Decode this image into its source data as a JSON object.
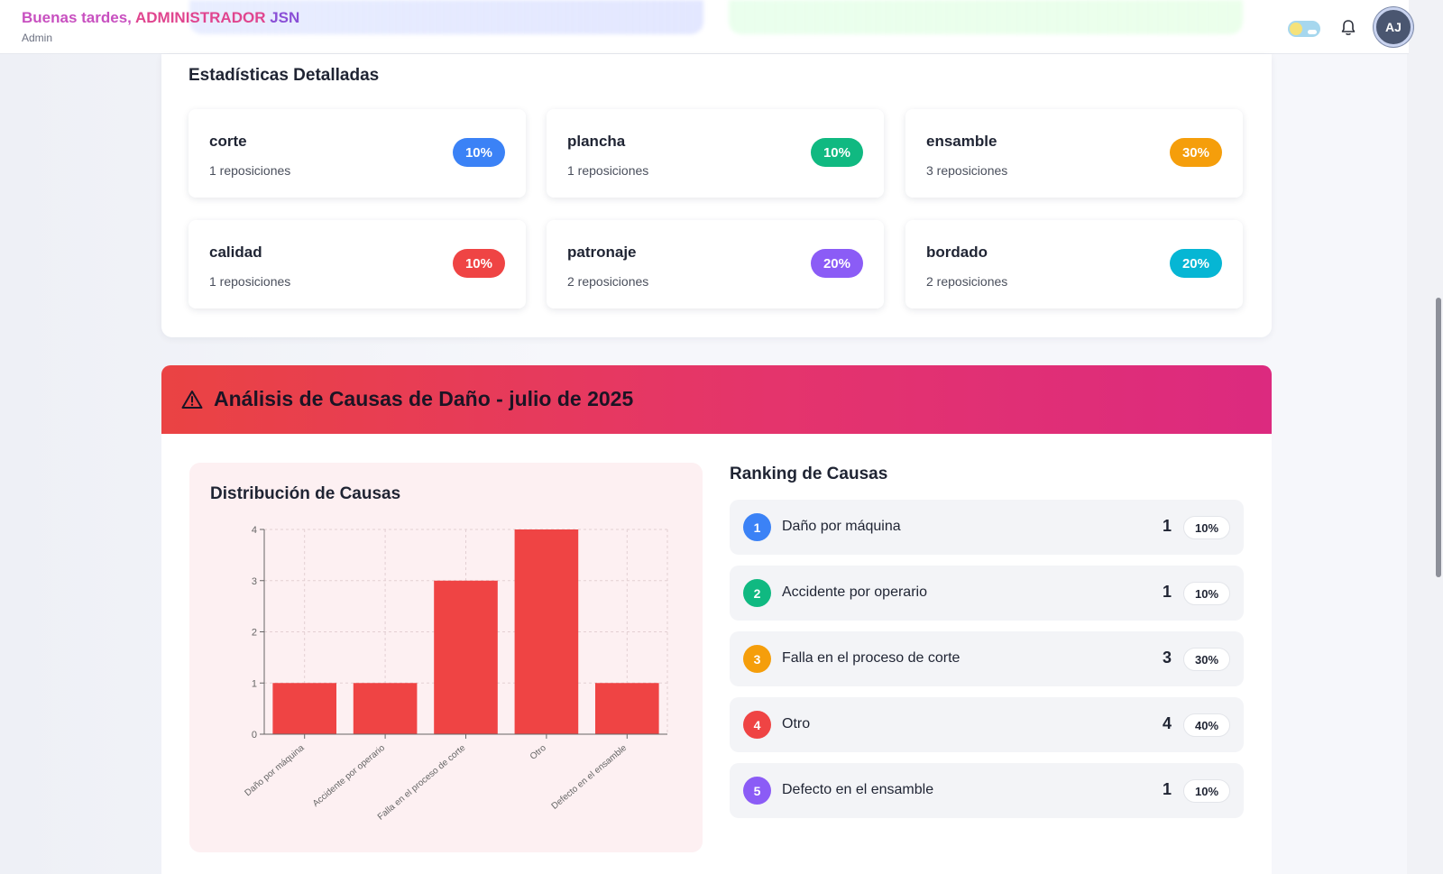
{
  "header": {
    "greeting_prefix": "Buenas tardes, ",
    "user_name": "ADMINISTRADOR ",
    "user_suffix": "JSN",
    "role": "Admin",
    "avatar_initials": "AJ"
  },
  "stats": {
    "title": "Estadísticas Detalladas",
    "items": [
      {
        "name": "corte",
        "count": "1 reposiciones",
        "percent": "10%",
        "color": "#3b82f6"
      },
      {
        "name": "plancha",
        "count": "1 reposiciones",
        "percent": "10%",
        "color": "#10b981"
      },
      {
        "name": "ensamble",
        "count": "3 reposiciones",
        "percent": "30%",
        "color": "#f59e0b"
      },
      {
        "name": "calidad",
        "count": "1 reposiciones",
        "percent": "10%",
        "color": "#ef4444"
      },
      {
        "name": "patronaje",
        "count": "2 reposiciones",
        "percent": "20%",
        "color": "#8b5cf6"
      },
      {
        "name": "bordado",
        "count": "2 reposiciones",
        "percent": "20%",
        "color": "#06b6d4"
      }
    ]
  },
  "analysis": {
    "title": "Análisis de Causas de Daño - julio de 2025",
    "chart_title": "Distribución de Causas",
    "ranking_title": "Ranking de Causas",
    "ranking": [
      {
        "rank": "1",
        "label": "Daño por máquina",
        "count": "1",
        "percent": "10%",
        "color": "#3b82f6"
      },
      {
        "rank": "2",
        "label": "Accidente por operario",
        "count": "1",
        "percent": "10%",
        "color": "#10b981"
      },
      {
        "rank": "3",
        "label": "Falla en el proceso de corte",
        "count": "3",
        "percent": "30%",
        "color": "#f59e0b"
      },
      {
        "rank": "4",
        "label": "Otro",
        "count": "4",
        "percent": "40%",
        "color": "#ef4444"
      },
      {
        "rank": "5",
        "label": "Defecto en el ensamble",
        "count": "1",
        "percent": "10%",
        "color": "#8b5cf6"
      }
    ]
  },
  "chart_data": {
    "type": "bar",
    "title": "Distribución de Causas",
    "categories": [
      "Daño por máquina",
      "Accidente por operario",
      "Falla en el proceso de corte",
      "Otro",
      "Defecto en el ensamble"
    ],
    "values": [
      1,
      1,
      3,
      4,
      1
    ],
    "ylim": [
      0,
      4
    ],
    "yticks": [
      0,
      1,
      2,
      3,
      4
    ],
    "grid": true,
    "bar_color": "#ef4444"
  }
}
